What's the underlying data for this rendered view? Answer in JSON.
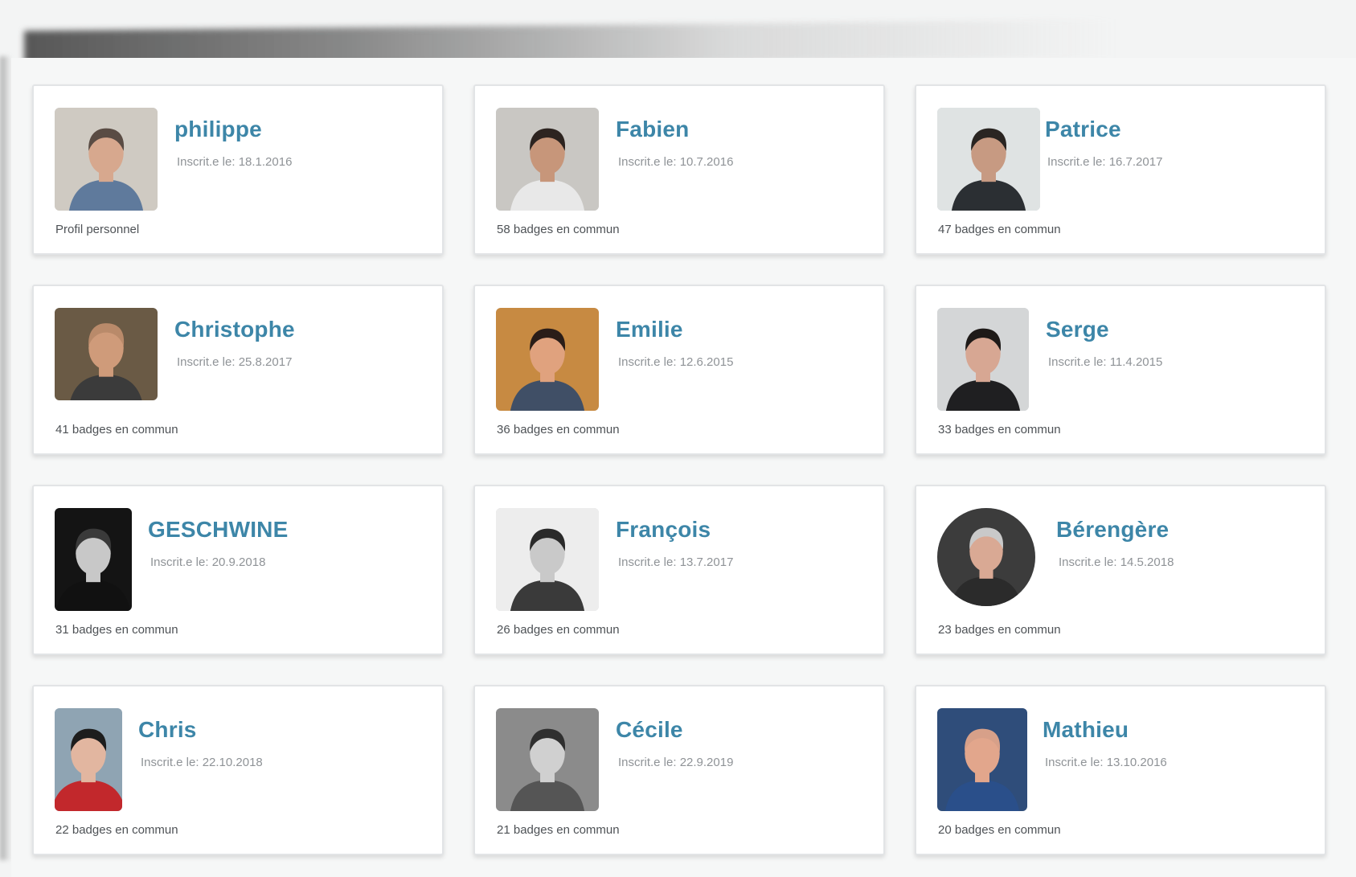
{
  "members": [
    {
      "name": "philippe",
      "registered": "Inscrit.e le: 18.1.2016",
      "footer": "Profil personnel",
      "avatar_bg": "#cfcac2",
      "avatar_skin": "#d7a88e",
      "avatar_hair": "#5a4c44",
      "avatar_shirt": "#5f7a9c"
    },
    {
      "name": "Fabien",
      "registered": "Inscrit.e le: 10.7.2016",
      "footer": "58 badges en commun",
      "avatar_bg": "#c9c7c3",
      "avatar_skin": "#c7967a",
      "avatar_hair": "#2d2420",
      "avatar_shirt": "#e8e8e8"
    },
    {
      "name": "Patrice",
      "registered": "Inscrit.e le: 16.7.2017",
      "footer": "47 badges en commun",
      "avatar_bg": "#dfe3e3",
      "avatar_skin": "#c79a82",
      "avatar_hair": "#2a2522",
      "avatar_shirt": "#2b2f33"
    },
    {
      "name": "Christophe",
      "registered": "Inscrit.e le: 25.8.2017",
      "footer": "41 badges en commun",
      "avatar_bg": "#6a5a45",
      "avatar_skin": "#cf9b7a",
      "avatar_hair": "#b98a6a",
      "avatar_shirt": "#3b3b3b"
    },
    {
      "name": "Emilie",
      "registered": "Inscrit.e le: 12.6.2015",
      "footer": "36 badges en commun",
      "avatar_bg": "#c78a42",
      "avatar_skin": "#e0a27e",
      "avatar_hair": "#2a1d18",
      "avatar_shirt": "#404f66"
    },
    {
      "name": "Serge",
      "registered": "Inscrit.e le: 11.4.2015",
      "footer": "33 badges en commun",
      "avatar_bg": "#d4d6d7",
      "avatar_skin": "#d7a793",
      "avatar_hair": "#1e1a18",
      "avatar_shirt": "#1f1f21"
    },
    {
      "name": "GESCHWINE",
      "registered": "Inscrit.e le: 20.9.2018",
      "footer": "31 badges en commun",
      "avatar_bg": "#141414",
      "avatar_skin": "#c8c8c8",
      "avatar_hair": "#3a3a3a",
      "avatar_shirt": "#111111"
    },
    {
      "name": "François",
      "registered": "Inscrit.e le: 13.7.2017",
      "footer": "26 badges en commun",
      "avatar_bg": "#ededed",
      "avatar_skin": "#c9c9c9",
      "avatar_hair": "#2a2a2a",
      "avatar_shirt": "#3a3a3a"
    },
    {
      "name": "Bérengère",
      "registered": "Inscrit.e le: 14.5.2018",
      "footer": "23 badges en commun",
      "avatar_bg": "#3c3c3c",
      "avatar_skin": "#d9a994",
      "avatar_hair": "#c9c9c9",
      "avatar_shirt": "#2b2b2b"
    },
    {
      "name": "Chris",
      "registered": "Inscrit.e le: 22.10.2018",
      "footer": "22 badges en commun",
      "avatar_bg": "#8fa4b3",
      "avatar_skin": "#e2b6a0",
      "avatar_hair": "#1d1d1d",
      "avatar_shirt": "#c2282c"
    },
    {
      "name": "Cécile",
      "registered": "Inscrit.e le: 22.9.2019",
      "footer": "21 badges en commun",
      "avatar_bg": "#8b8b8b",
      "avatar_skin": "#d0d0d0",
      "avatar_hair": "#2f2f2f",
      "avatar_shirt": "#555555"
    },
    {
      "name": "Mathieu",
      "registered": "Inscrit.e le: 13.10.2016",
      "footer": "20 badges en commun",
      "avatar_bg": "#2f4d7a",
      "avatar_skin": "#e2a68c",
      "avatar_hair": "#d7a089",
      "avatar_shirt": "#2a4f8a"
    }
  ],
  "colors": {
    "name": "#3d86a8",
    "date": "#8f9397",
    "footer": "#4e5256",
    "card_border": "#e2e4e6"
  }
}
